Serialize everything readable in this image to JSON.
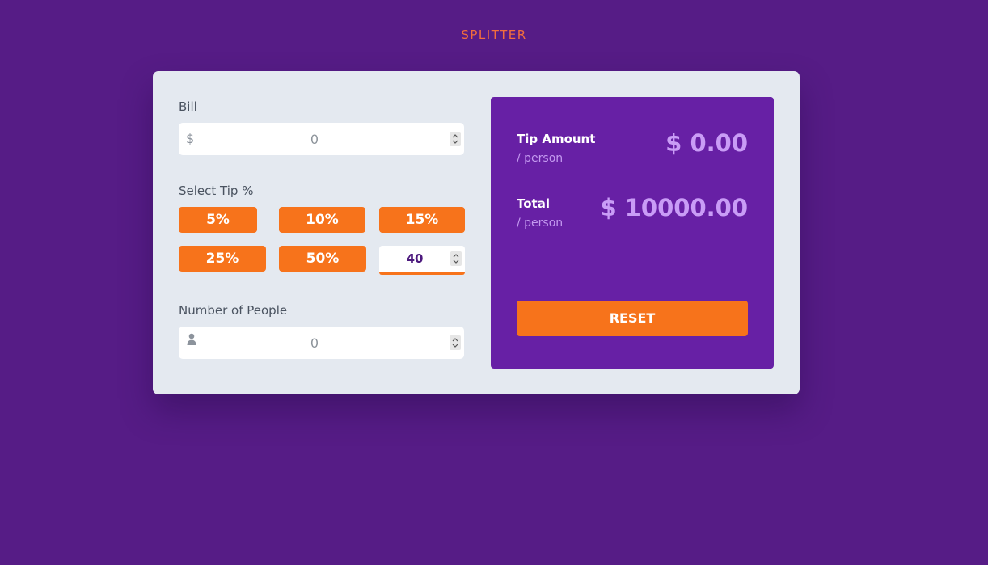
{
  "app": {
    "title": "SPLITTER"
  },
  "bill": {
    "label": "Bill",
    "prefix": "$",
    "value": "0"
  },
  "tip": {
    "label": "Select Tip %",
    "options": [
      "5%",
      "10%",
      "15%",
      "25%",
      "50%"
    ],
    "custom_value": "40"
  },
  "people": {
    "label": "Number of People",
    "value": "0",
    "icon": "person-icon"
  },
  "results": {
    "tip_amount_label": "Tip Amount",
    "tip_amount_sub": "/ person",
    "tip_amount_value": "$ 0.00",
    "total_label": "Total",
    "total_sub": "/ person",
    "total_value": "$ 10000.00",
    "reset_label": "RESET"
  },
  "colors": {
    "background": "#561c86",
    "card": "#e4e9f0",
    "accent": "#f7731b",
    "result_panel": "#6720a5",
    "result_value": "#c99cf6"
  }
}
